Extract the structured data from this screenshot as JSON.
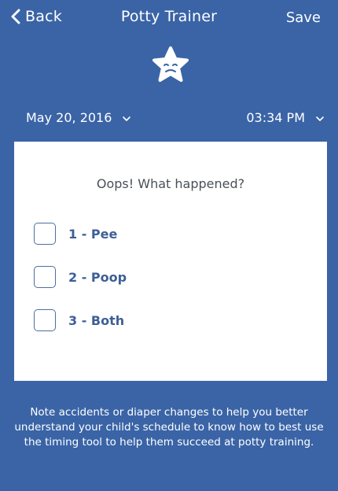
{
  "nav": {
    "back_label": "Back",
    "title": "Potty Trainer",
    "save_label": "Save"
  },
  "icons": {
    "back": "chevron-left-icon",
    "mascot": "sad-star-icon",
    "dropdown": "chevron-down-icon"
  },
  "datetime": {
    "date": "May 20, 2016",
    "time": "03:34 PM"
  },
  "card": {
    "heading": "Oops! What happened?",
    "options": [
      {
        "label": "1 - Pee",
        "checked": false
      },
      {
        "label": "2 - Poop",
        "checked": false
      },
      {
        "label": "3 - Both",
        "checked": false
      }
    ]
  },
  "footer": {
    "note": "Note accidents or diaper changes to help you better understand your child's schedule to know how to best use the timing tool to help them succeed at potty training."
  },
  "colors": {
    "background": "#3a64a6",
    "card": "#ffffff",
    "option_text": "#3d5f95",
    "heading_text": "#4a4f57"
  }
}
